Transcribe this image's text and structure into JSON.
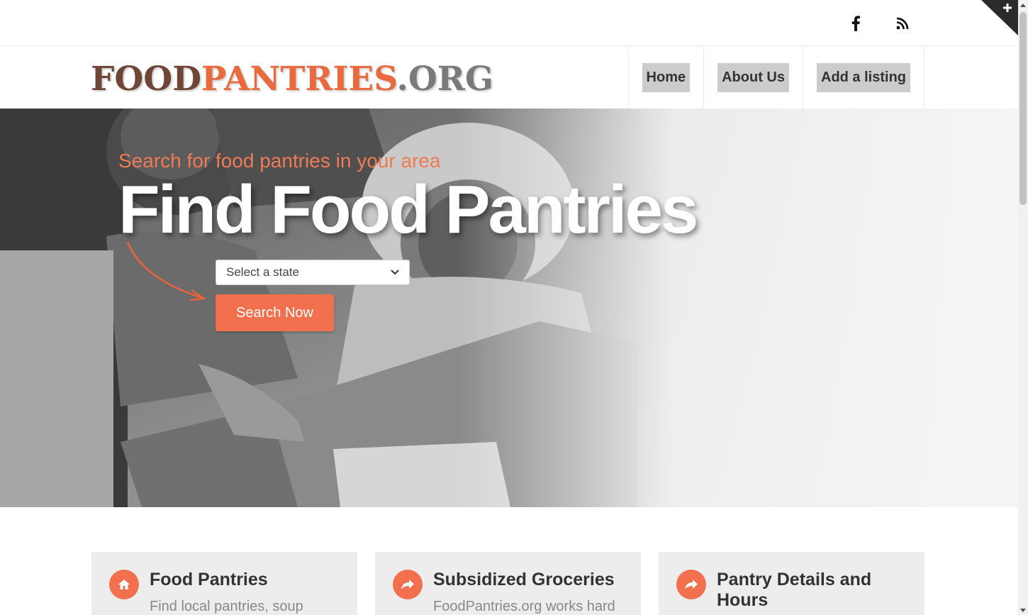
{
  "social": {
    "facebook_icon": "facebook-icon",
    "rss_icon": "rss-icon",
    "corner_icon": "plus-icon"
  },
  "header": {
    "logo": {
      "part1": "FOOD",
      "part2": "PANTRIES",
      "part3": ".ORG"
    },
    "nav": [
      "Home",
      "About Us",
      "Add a listing"
    ]
  },
  "hero": {
    "tagline": "Search for food pantries in your area",
    "title": "Find Food Pantries",
    "select_value": "Select a state",
    "button_label": "Search Now"
  },
  "cards": [
    {
      "icon": "home-icon",
      "title": "Food Pantries",
      "text": "Find local pantries, soup"
    },
    {
      "icon": "share-arrow-icon",
      "title": "Subsidized Groceries",
      "text": "FoodPantries.org works hard"
    },
    {
      "icon": "share-arrow-icon",
      "title": "Pantry Details and Hours",
      "text": ""
    }
  ],
  "colors": {
    "accent": "#f2704d",
    "logo_brown": "#6e4638",
    "logo_orange": "#ea6a40",
    "logo_gray": "#7a7a7a",
    "nav_bg": "#cccccc",
    "card_bg": "#ededed"
  }
}
